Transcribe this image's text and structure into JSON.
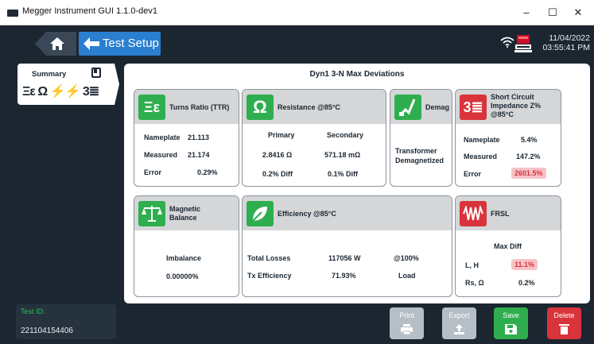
{
  "window": {
    "title": "Megger Instrument GUI 1.1.0-dev1",
    "min": "–",
    "max": "☐",
    "close": "✕"
  },
  "header": {
    "home_icon": "home-icon",
    "back_label": "Test Setup",
    "date": "11/04/2022",
    "time": "03:55:41 PM"
  },
  "sidebar": {
    "summary_label": "Summary",
    "test_icons": "Ξε Ω ⚡⚡ 3≣"
  },
  "main": {
    "title": "Dyn1 3-N Max Deviations",
    "ttr": {
      "title": "Turns Ratio (TTR)",
      "icon": "Ξε",
      "rows": [
        {
          "label": "Nameplate",
          "value": "21.113"
        },
        {
          "label": "Measured",
          "value": "21.174"
        },
        {
          "label": "Error",
          "value": "0.29%"
        }
      ]
    },
    "resistance": {
      "title": "Resistance @85°C",
      "icon": "Ω",
      "col1_head": "Primary",
      "col2_head": "Secondary",
      "col1_val": "2.8416 Ω",
      "col2_val": "571.18 mΩ",
      "col1_diff": "0.2% Diff",
      "col2_diff": "0.1% Diff"
    },
    "demag": {
      "title": "Demag",
      "line1": "Transformer",
      "line2": "Demagnetized"
    },
    "short_circuit": {
      "title_l1": "Short Circuit",
      "title_l2": "Impedance Z%",
      "title_l3": "@85°C",
      "icon": "3≣",
      "rows": [
        {
          "label": "Nameplate",
          "value": "5.4%"
        },
        {
          "label": "Measured",
          "value": "147.2%"
        },
        {
          "label": "Error",
          "value": "2601.5%"
        }
      ]
    },
    "magnetic": {
      "title_l1": "Magnetic",
      "title_l2": "Balance",
      "label": "Imbalance",
      "value": "0.00000%"
    },
    "efficiency": {
      "title": "Efficiency @85°C",
      "r1_label": "Total Losses",
      "r1_value": "117056 W",
      "r1_extra": "@100%",
      "r2_label": "Tx Efficiency",
      "r2_value": "71.93%",
      "r2_extra": "Load"
    },
    "frsl": {
      "title": "FRSL",
      "head": "Max Diff",
      "r1_label": "L, H",
      "r1_value": "11.1%",
      "r2_label": "Rs, Ω",
      "r2_value": "0.2%"
    }
  },
  "footer": {
    "test_id_label": "Test ID:",
    "test_id_value": "221104154406",
    "print_label": "Print",
    "export_label": "Export",
    "save_label": "Save",
    "delete_label": "Delete"
  },
  "colors": {
    "green": "#2fae4f",
    "red": "#d9333c",
    "blue": "#2a7fd0",
    "bg": "#1b2631"
  }
}
